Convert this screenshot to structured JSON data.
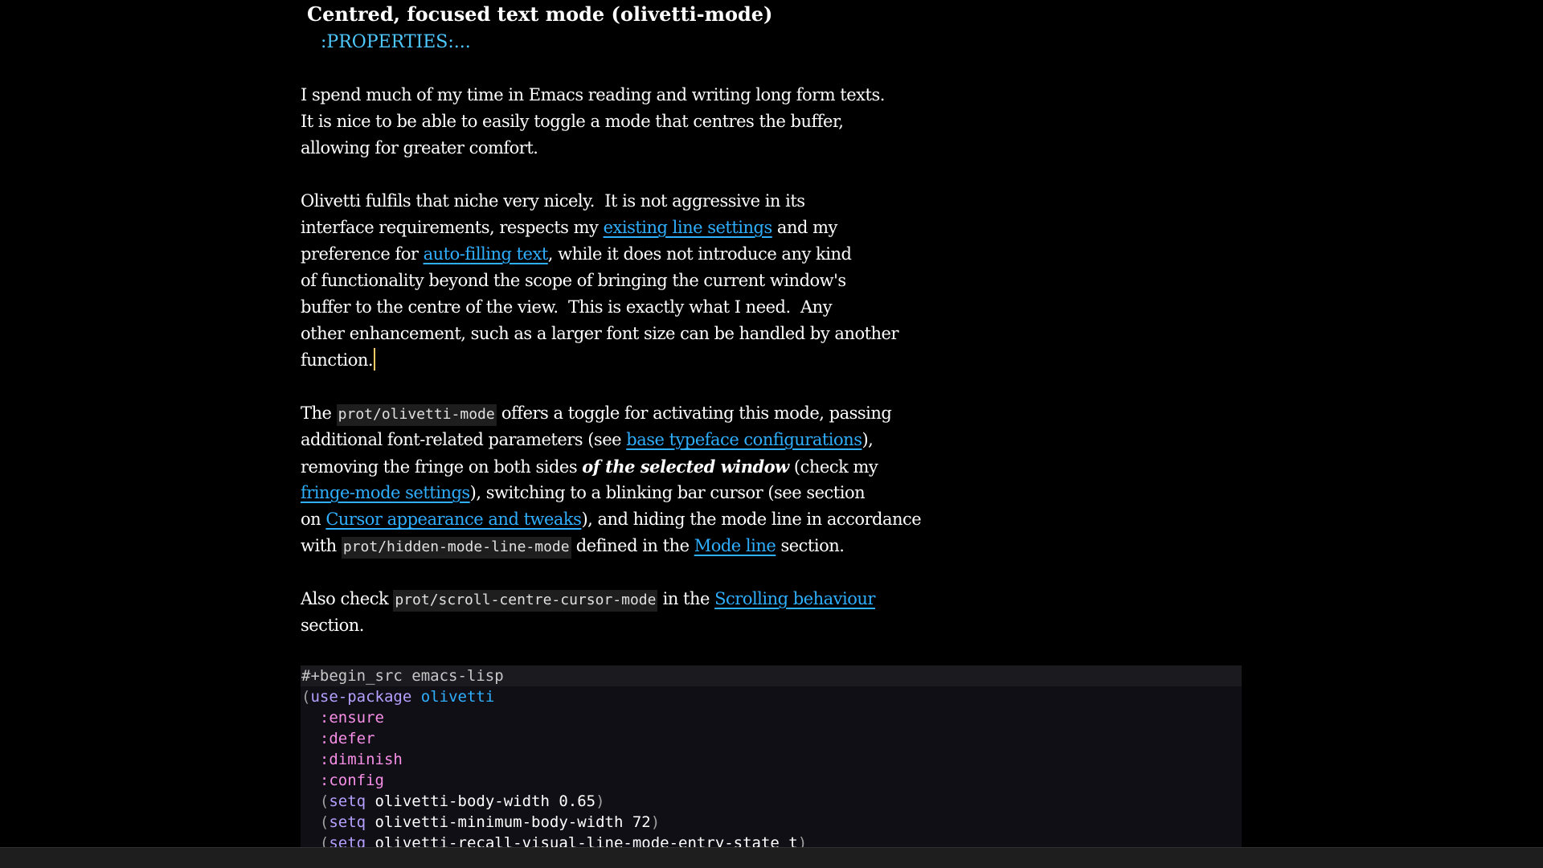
{
  "heading": {
    "title": "Centred, focused text mode (olivetti-mode)",
    "properties": ":PROPERTIES:..."
  },
  "para1": {
    "l1": "I spend much of my time in Emacs reading and writing long form texts.",
    "l2": "It is nice to be able to easily toggle a mode that centres the buffer,",
    "l3": "allowing for greater comfort."
  },
  "para2": {
    "l1": "Olivetti fulfils that niche very nicely.  It is not aggressive in its",
    "l2a": "interface requirements, respects my ",
    "l2link": "existing line settings",
    "l2b": " and my",
    "l3a": "preference for ",
    "l3link": "auto-filling text",
    "l3b": ", while it does not introduce any kind",
    "l4": "of functionality beyond the scope of bringing the current window's",
    "l5": "buffer to the centre of the view.  This is exactly what I need.  Any",
    "l6": "other enhancement, such as a larger font size can be handled by another",
    "l7": "function."
  },
  "para3": {
    "l1a": "The ",
    "l1code": "prot/olivetti-mode",
    "l1b": " offers a toggle for activating this mode, passing",
    "l2a": "additional font-related parameters (see ",
    "l2link": "base typeface configurations",
    "l2b": "),",
    "l3a": "removing the fringe on both sides ",
    "l3em": "of the selected window",
    "l3b": " (check my",
    "l4link": "fringe-mode settings",
    "l4b": "), switching to a blinking bar cursor (see section",
    "l5a": "on ",
    "l5link": "Cursor appearance and tweaks",
    "l5b": "), and hiding the mode line in accordance",
    "l6a": "with ",
    "l6code": "prot/hidden-mode-line-mode",
    "l6b": " defined in the ",
    "l6link": "Mode line",
    "l6c": " section."
  },
  "para4": {
    "l1a": "Also check ",
    "l1code": "prot/scroll-centre-cursor-mode",
    "l1b": " in the ",
    "l1link": "Scrolling behaviour",
    "l2": "section."
  },
  "src": {
    "begin": "#+begin_src emacs-lisp",
    "use_package": "use-package",
    "package_name": "olivetti",
    "ensure": ":ensure",
    "defer": ":defer",
    "diminish": ":diminish",
    "config": ":config",
    "setq": "setq",
    "s1": " olivetti-body-width 0.65",
    "s2": " olivetti-minimum-body-width 72",
    "s3": " olivetti-recall-visual-line-mode-entry-state t"
  },
  "colors": {
    "background": "#000000",
    "link": "#2fafff",
    "properties": "#4ec9ff",
    "keyword": "#b6a0ff",
    "builtin_key": "#f78fe7",
    "cursor": "#ffcc66"
  }
}
